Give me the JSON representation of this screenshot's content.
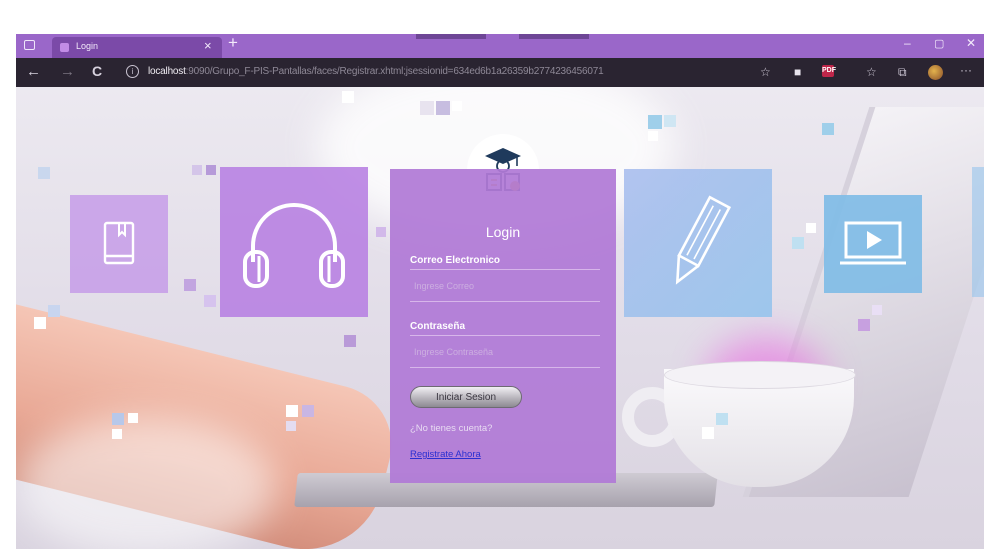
{
  "browser": {
    "tab_title": "Login",
    "tab_close": "×",
    "new_tab": "+",
    "window_controls": {
      "minimize": "–",
      "maximize": "▢",
      "close": "✕"
    },
    "nav": {
      "back": "←",
      "forward": "→",
      "reload": "C"
    },
    "url_host": "localhost",
    "url_rest": ":9090/Grupo_F-PIS-Pantallas/faces/Registrar.xhtml;jsessionid=634ed6b1a26359b2774236456071",
    "extensions": [
      "☆",
      "■",
      "PDF",
      "☆",
      "⧉"
    ],
    "menu": "···"
  },
  "login": {
    "title": "Login",
    "email_label": "Correo Electronico",
    "email_placeholder": "Ingrese Correo",
    "password_label": "Contraseña",
    "password_placeholder": "Ingrese Contraseña",
    "submit_label": "Iniciar Sesion",
    "no_account_text": "¿No tienes cuenta?",
    "register_link": "Registrate Ahora"
  },
  "colors": {
    "tab_bar": "#9a67c9",
    "address_bar": "#2a2431",
    "card": "#b07ad6",
    "link": "#2b2fd1"
  },
  "icons": [
    "book-icon",
    "headphones-icon",
    "pencil-icon",
    "video-play-icon",
    "graduate-logo-icon"
  ]
}
